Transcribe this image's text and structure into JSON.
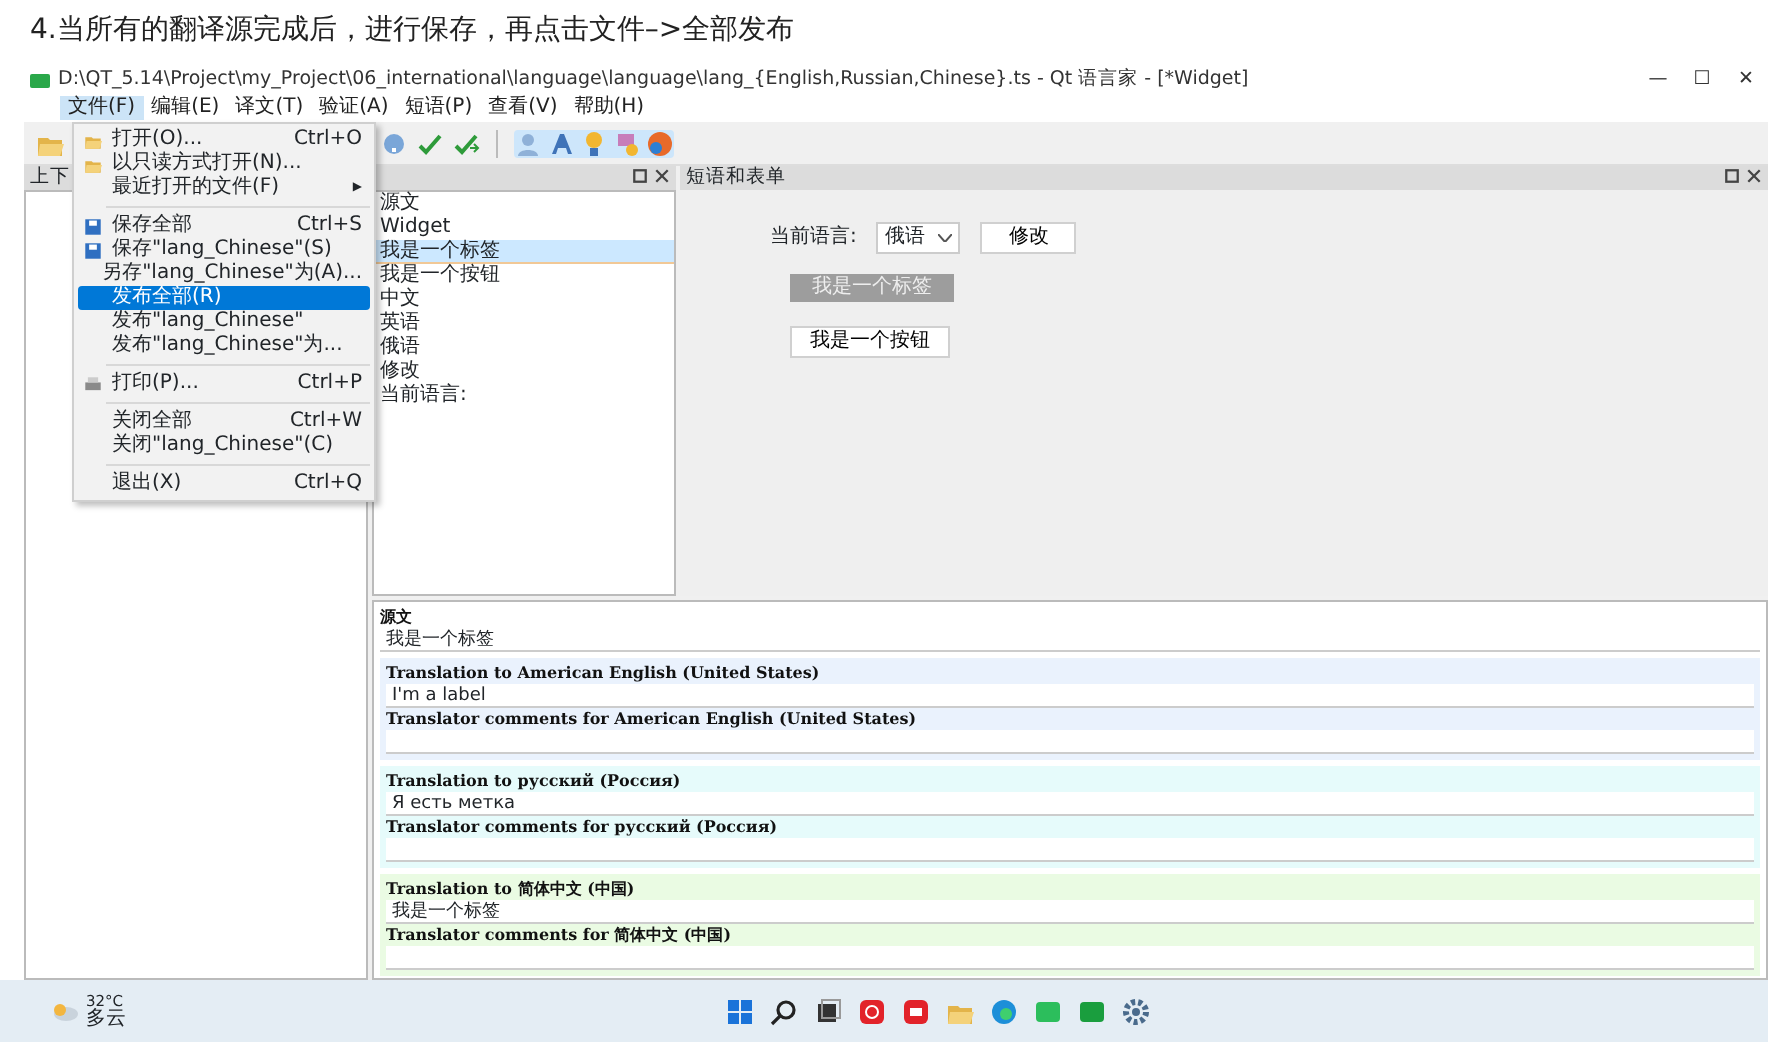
{
  "heading": "4.当所有的翻译源完成后，进行保存，再点击文件–>全部发布",
  "window": {
    "title": "D:\\QT_5.14\\Project\\my_Project\\06_international\\language\\language\\lang_{English,Russian,Chinese}.ts - Qt 语言家 - [*Widget]",
    "controls": [
      "—",
      "☐",
      "✕"
    ]
  },
  "menubar": [
    {
      "label": "文件(F)",
      "selected": true
    },
    {
      "label": "编辑(E)",
      "selected": false
    },
    {
      "label": "译文(T)",
      "selected": false
    },
    {
      "label": "验证(A)",
      "selected": false
    },
    {
      "label": "短语(P)",
      "selected": false
    },
    {
      "label": "查看(V)",
      "selected": false
    },
    {
      "label": "帮助(H)",
      "selected": false
    }
  ],
  "file_menu": [
    {
      "kind": "folder-item",
      "label": "打开(O)...",
      "shortcut": "Ctrl+O",
      "selected": false
    },
    {
      "kind": "folder-item",
      "label": "以只读方式打开(N)...",
      "selected": false
    },
    {
      "kind": "submenu",
      "label": "最近打开的文件(F)",
      "arrow": "▶",
      "selected": false
    },
    {
      "kind": "separator"
    },
    {
      "kind": "save-item",
      "label": "保存全部",
      "shortcut": "Ctrl+S",
      "selected": false
    },
    {
      "kind": "save-item",
      "label": "保存\"lang_Chinese\"(S)",
      "selected": false
    },
    {
      "kind": "item",
      "label": "另存\"lang_Chinese\"为(A)...",
      "selected": false
    },
    {
      "kind": "item",
      "label": "发布全部(R)",
      "selected": true
    },
    {
      "kind": "item",
      "label": "发布\"lang_Chinese\"",
      "selected": false
    },
    {
      "kind": "item",
      "label": "发布\"lang_Chinese\"为...",
      "selected": false
    },
    {
      "kind": "separator"
    },
    {
      "kind": "print-item",
      "label": "打印(P)...",
      "shortcut": "Ctrl+P",
      "selected": false
    },
    {
      "kind": "separator"
    },
    {
      "kind": "item",
      "label": "关闭全部",
      "shortcut": "Ctrl+W",
      "selected": false
    },
    {
      "kind": "item",
      "label": "关闭\"lang_Chinese\"(C)",
      "selected": false
    },
    {
      "kind": "separator"
    },
    {
      "kind": "item",
      "label": "退出(X)",
      "shortcut": "Ctrl+Q",
      "selected": false
    }
  ],
  "context_dock": {
    "title": "上下"
  },
  "strings": [
    {
      "label": "源文",
      "selected": false
    },
    {
      "label": "Widget",
      "selected": false
    },
    {
      "label": "我是一个标签",
      "selected": true
    },
    {
      "label": "我是一个按钮",
      "selected": false
    },
    {
      "label": "中文",
      "selected": false
    },
    {
      "label": "英语",
      "selected": false
    },
    {
      "label": "俄语",
      "selected": false
    },
    {
      "label": "修改",
      "selected": false
    },
    {
      "label": "当前语言:",
      "selected": false
    }
  ],
  "form_preview": {
    "title": "短语和表单",
    "language_label": "当前语言:",
    "language_combo": "俄语",
    "change_button": "修改",
    "label_widget": "我是一个标签",
    "push_button": "我是一个按钮"
  },
  "editor": {
    "source_heading": "源文",
    "source_text": "我是一个标签",
    "sections": [
      {
        "color": "#eaf2fd",
        "translation_heading": "Translation to American English (United States)",
        "translation": "I'm a label",
        "comments_heading": "Translator comments for American English (United States)"
      },
      {
        "color": "#e6fbfb",
        "translation_heading": "Translation to русский (Россия)",
        "translation": "Я есть метка",
        "comments_heading": "Translator comments for русский (Россия)"
      },
      {
        "color": "#eafbe3",
        "translation_heading": "Translation to 简体中文 (中国)",
        "translation": "我是一个标签",
        "comments_heading": "Translator comments for 简体中文 (中国)"
      }
    ]
  },
  "taskbar": {
    "temperature": "32°C",
    "weather": "多云"
  }
}
